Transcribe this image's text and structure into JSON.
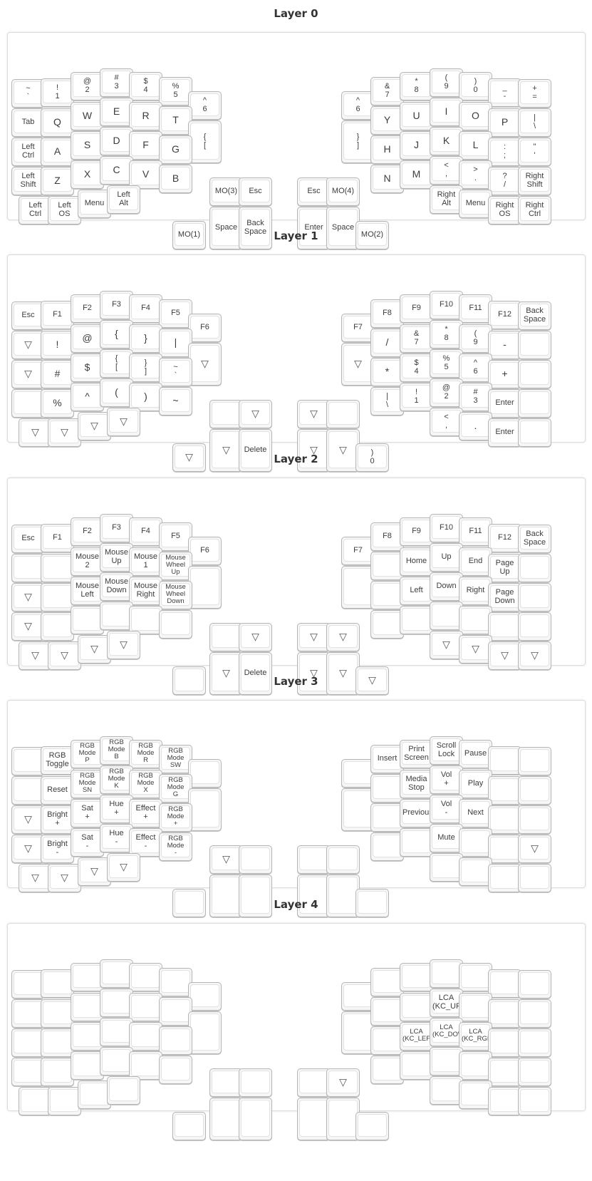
{
  "layers": [
    {
      "title": "Layer 0",
      "keys": [
        "~\n`",
        "!\n1",
        "@\n2",
        "#\n3",
        "$\n4",
        "%\n5",
        "^\n6",
        "^\n6",
        "&\n7",
        "*\n8",
        "(\n9",
        ")\n0",
        "_\n-",
        "+\n=",
        "Tab",
        "Q",
        "W",
        "E",
        "R",
        "T",
        "{\n[",
        "}\n]",
        "Y",
        "U",
        "I",
        "O",
        "P",
        "|\n\\",
        "Left\nCtrl",
        "A",
        "S",
        "D",
        "F",
        "G",
        "H",
        "J",
        "K",
        "L",
        ":\n;",
        "\"\n'",
        "Left\nShift",
        "Z",
        "X",
        "C",
        "V",
        "B",
        "N",
        "M",
        "<\n,",
        ">\n.",
        "?\n/",
        "Right\nShift",
        "Left\nCtrl",
        "Left\nOS",
        "Menu",
        "Left\nAlt",
        "Right\nAlt",
        "Menu",
        "Right\nOS",
        "Right\nCtrl",
        "MO(3)",
        "Esc",
        "Space",
        "Back\nSpace",
        "MO(1)",
        "Esc",
        "MO(4)",
        "Enter",
        "Space",
        "MO(2)"
      ]
    },
    {
      "title": "Layer 1",
      "keys": [
        "Esc",
        "F1",
        "F2",
        "F3",
        "F4",
        "F5",
        "F6",
        "F7",
        "F8",
        "F9",
        "F10",
        "F11",
        "F12",
        "Back\nSpace",
        "▽",
        "!",
        "@",
        "{",
        "}",
        "|",
        "▽",
        "▽",
        "/",
        "&\n7",
        "*\n8",
        "(\n9",
        "-",
        "",
        "▽",
        "#",
        "$",
        "{\n[",
        "}\n]",
        "~\n`",
        "*",
        "$\n4",
        "%\n5",
        "^\n6",
        "+",
        "",
        "",
        "%",
        "^",
        "(",
        ")",
        "~",
        "|\n\\",
        "!\n1",
        "@\n2",
        "#\n3",
        "Enter",
        "",
        "▽",
        "▽",
        "▽",
        "▽",
        "<\n,",
        ".",
        "Enter",
        "",
        "",
        "▽",
        "▽",
        "Delete",
        "▽",
        "▽",
        "",
        "▽",
        "▽",
        ")\n0"
      ]
    },
    {
      "title": "Layer 2",
      "keys": [
        "Esc",
        "F1",
        "F2",
        "F3",
        "F4",
        "F5",
        "F6",
        "F7",
        "F8",
        "F9",
        "F10",
        "F11",
        "F12",
        "Back\nSpace",
        "",
        "",
        "Mouse\n2",
        "Mouse\nUp",
        "Mouse\n1",
        "Mouse\nWheel\nUp",
        "",
        "",
        "",
        "Home",
        "Up",
        "End",
        "Page\nUp",
        "",
        "▽",
        "",
        "Mouse\nLeft",
        "Mouse\nDown",
        "Mouse\nRight",
        "Mouse\nWheel\nDown",
        "",
        "Left",
        "Down",
        "Right",
        "Page\nDown",
        "",
        "▽",
        "",
        "",
        "",
        "",
        "",
        "",
        "",
        "",
        "",
        "",
        "",
        "▽",
        "▽",
        "▽",
        "▽",
        "▽",
        "▽",
        "▽",
        "▽",
        "",
        "▽",
        "▽",
        "Delete",
        "",
        "▽",
        "▽",
        "▽",
        "▽",
        "▽"
      ]
    },
    {
      "title": "Layer 3",
      "keys": [
        "",
        "RGB\nToggle",
        "RGB\nMode\nP",
        "RGB\nMode\nB",
        "RGB\nMode\nR",
        "RGB\nMode\nSW",
        "",
        "",
        "Insert",
        "Print\nScreen",
        "Scroll\nLock",
        "Pause",
        "",
        "",
        "",
        "Reset",
        "RGB\nMode\nSN",
        "RGB\nMode\nK",
        "RGB\nMode\nX",
        "RGB\nMode\nG",
        "",
        "",
        "",
        "Media\nStop",
        "Vol\n+",
        "Play",
        "",
        "",
        "▽",
        "Bright\n+",
        "Sat\n+",
        "Hue\n+",
        "Effect\n+",
        "RGB\nMode\n+",
        "",
        "Previous",
        "Vol\n-",
        "Next",
        "",
        "",
        "▽",
        "Bright\n-",
        "Sat\n-",
        "Hue\n-",
        "Effect\n-",
        "RGB\nMode\n-",
        "",
        "",
        "Mute",
        "",
        "",
        "▽",
        "▽",
        "▽",
        "▽",
        "▽",
        "",
        "",
        "",
        "",
        "▽",
        "",
        "",
        "",
        "",
        "",
        "",
        "",
        "",
        ""
      ]
    },
    {
      "title": "Layer 4",
      "keys": [
        "",
        "",
        "",
        "",
        "",
        "",
        "",
        "",
        "",
        "",
        "",
        "",
        "",
        "",
        "",
        "",
        "",
        "",
        "",
        "",
        "",
        "",
        "",
        "",
        "LCA\n(KC_UP)",
        "",
        "",
        "",
        "",
        "",
        "",
        "",
        "",
        "",
        "",
        "LCA\n(KC_LEFT)",
        "LCA\n(KC_DOWN)",
        "LCA\n(KC_RGHT)",
        "",
        "",
        "",
        "",
        "",
        "",
        "",
        "",
        "",
        "",
        "",
        "",
        "",
        "",
        "",
        "",
        "",
        "",
        "",
        "",
        "",
        "",
        "",
        "",
        "",
        "",
        "",
        "",
        "▽",
        "",
        "",
        ""
      ]
    }
  ]
}
